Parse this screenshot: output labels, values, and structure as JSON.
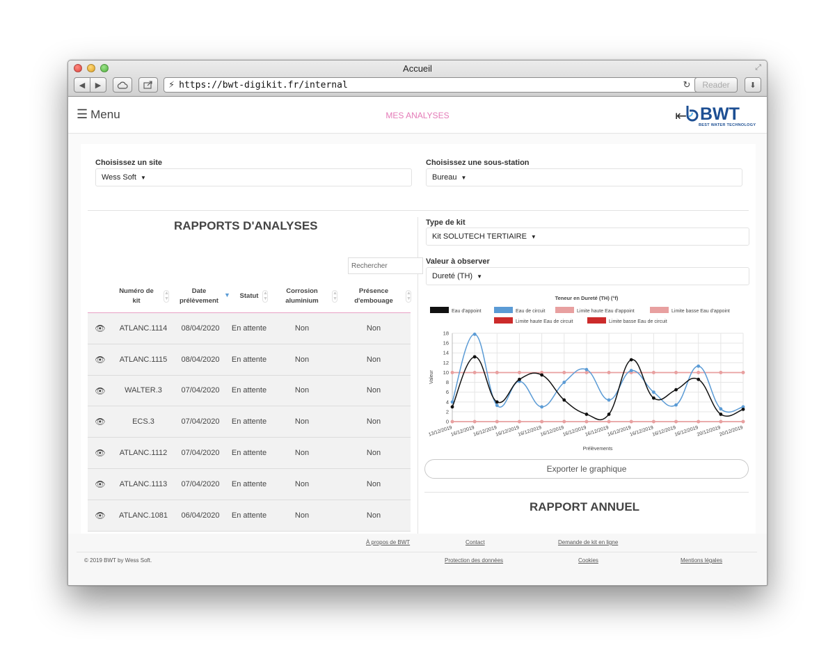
{
  "window": {
    "title": "Accueil"
  },
  "browser": {
    "url": "https://bwt-digikit.fr/internal",
    "reader_label": "Reader"
  },
  "header": {
    "menu_label": "Menu",
    "page_title": "MES ANALYSES",
    "logo_text": "BWT",
    "logo_tagline": "BEST WATER TECHNOLOGY"
  },
  "filters": {
    "site_label": "Choisissez un site",
    "site_value": "Wess Soft",
    "substation_label": "Choisissez une sous-station",
    "substation_value": "Bureau"
  },
  "reports": {
    "title": "RAPPORTS D'ANALYSES",
    "search_placeholder": "Rechercher",
    "columns": [
      {
        "key": "num",
        "label": "Numéro de kit"
      },
      {
        "key": "date",
        "label": "Date prélèvement"
      },
      {
        "key": "statut",
        "label": "Statut"
      },
      {
        "key": "corrosion",
        "label": "Corrosion aluminium"
      },
      {
        "key": "embouage",
        "label": "Présence d'embouage"
      }
    ],
    "rows": [
      {
        "num": "ATLANC.1114",
        "date": "08/04/2020",
        "statut": "En attente",
        "corrosion": "Non",
        "embouage": "Non"
      },
      {
        "num": "ATLANC.1115",
        "date": "08/04/2020",
        "statut": "En attente",
        "corrosion": "Non",
        "embouage": "Non"
      },
      {
        "num": "WALTER.3",
        "date": "07/04/2020",
        "statut": "En attente",
        "corrosion": "Non",
        "embouage": "Non"
      },
      {
        "num": "ECS.3",
        "date": "07/04/2020",
        "statut": "En attente",
        "corrosion": "Non",
        "embouage": "Non"
      },
      {
        "num": "ATLANC.1112",
        "date": "07/04/2020",
        "statut": "En attente",
        "corrosion": "Non",
        "embouage": "Non"
      },
      {
        "num": "ATLANC.1113",
        "date": "07/04/2020",
        "statut": "En attente",
        "corrosion": "Non",
        "embouage": "Non"
      },
      {
        "num": "ATLANC.1081",
        "date": "06/04/2020",
        "statut": "En attente",
        "corrosion": "Non",
        "embouage": "Non"
      }
    ]
  },
  "graph_panel": {
    "kit_type_label": "Type de kit",
    "kit_type_value": "Kit SOLUTECH TERTIAIRE",
    "observe_label": "Valeur à observer",
    "observe_value": "Dureté (TH)",
    "export_label": "Exporter le graphique",
    "annual_title": "RAPPORT ANNUEL"
  },
  "chart_data": {
    "type": "line",
    "title": "Teneur en Dureté (TH) (°f)",
    "xlabel": "Prélèvements",
    "ylabel": "Valeur",
    "ylim": [
      0,
      18
    ],
    "yticks": [
      0,
      2,
      4,
      6,
      8,
      10,
      12,
      14,
      16,
      18
    ],
    "grid": true,
    "legend_position": "top",
    "categories": [
      "13/12/2019",
      "16/12/2019",
      "16/12/2019",
      "16/12/2019",
      "16/12/2019",
      "16/12/2019",
      "16/12/2019",
      "16/12/2019",
      "16/12/2019",
      "16/12/2019",
      "16/12/2019",
      "16/12/2019",
      "20/12/2019",
      "20/12/2019"
    ],
    "series": [
      {
        "name": "Eau d'appoint",
        "color": "#111111",
        "values": [
          3,
          13.2,
          4,
          8.6,
          9.5,
          4.4,
          1.5,
          1.5,
          12.6,
          4.8,
          6.5,
          8.6,
          1.5,
          2.5
        ]
      },
      {
        "name": "Eau de circuit",
        "color": "#5b9bd5",
        "values": [
          4,
          17.8,
          3.3,
          8.2,
          3,
          8,
          10.6,
          4.4,
          10.4,
          6,
          3.4,
          11.3,
          2.6,
          3
        ]
      },
      {
        "name": "Limite haute Eau d'appoint",
        "color": "#e8a0a0",
        "values": [
          10,
          10,
          10,
          10,
          10,
          10,
          10,
          10,
          10,
          10,
          10,
          10,
          10,
          10
        ]
      },
      {
        "name": "Limite basse Eau d'appoint",
        "color": "#e8a0a0",
        "values": [
          0,
          0,
          0,
          0,
          0,
          0,
          0,
          0,
          0,
          0,
          0,
          0,
          0,
          0
        ]
      },
      {
        "name": "Limite haute Eau de circuit",
        "color": "#cc2b2b",
        "values": [
          10,
          10,
          10,
          10,
          10,
          10,
          10,
          10,
          10,
          10,
          10,
          10,
          10,
          10
        ]
      },
      {
        "name": "Limite basse Eau de circuit",
        "color": "#cc2b2b",
        "values": [
          0,
          0,
          0,
          0,
          0,
          0,
          0,
          0,
          0,
          0,
          0,
          0,
          0,
          0
        ]
      }
    ]
  },
  "footer": {
    "about": "À propos de BWT",
    "contact": "Contact",
    "request_kit": "Demande de kit en ligne",
    "copyright": "© 2019 BWT by Wess Soft.",
    "privacy": "Protection des données",
    "cookies": "Cookies",
    "legal": "Mentions légales"
  }
}
